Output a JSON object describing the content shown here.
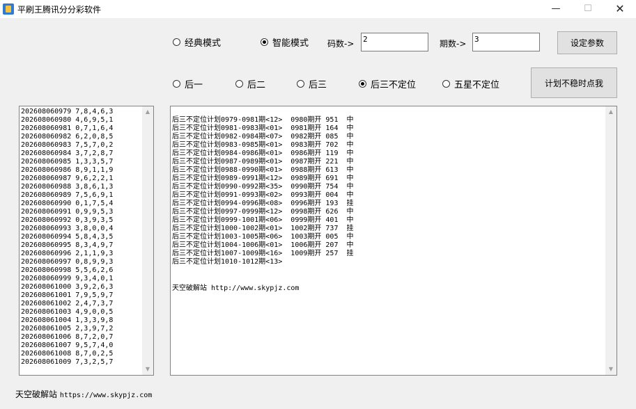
{
  "window": {
    "title": "平刷王腾讯分分彩软件",
    "min": "—",
    "max": "☐",
    "close": "✕"
  },
  "modes": [
    {
      "label": "经典模式",
      "checked": false
    },
    {
      "label": "智能模式",
      "checked": true
    }
  ],
  "params": {
    "code_label": "码数->",
    "code_value": "2",
    "period_label": "期数->",
    "period_value": "3",
    "set_button": "设定参数",
    "plan_button": "计划不稳时点我"
  },
  "positions": [
    {
      "label": "后一",
      "checked": false
    },
    {
      "label": "后二",
      "checked": false
    },
    {
      "label": "后三",
      "checked": false
    },
    {
      "label": "后三不定位",
      "checked": true
    },
    {
      "label": "五星不定位",
      "checked": false
    }
  ],
  "history": [
    "202608060979 7,8,4,6,3",
    "202608060980 4,6,9,5,1",
    "202608060981 0,7,1,6,4",
    "202608060982 6,2,0,8,5",
    "202608060983 7,5,7,0,2",
    "202608060984 3,7,2,8,7",
    "202608060985 1,3,3,5,7",
    "202608060986 8,9,1,1,9",
    "202608060987 9,6,2,2,1",
    "202608060988 3,8,6,1,3",
    "202608060989 7,5,6,9,1",
    "202608060990 0,1,7,5,4",
    "202608060991 0,9,9,5,3",
    "202608060992 0,3,9,3,5",
    "202608060993 3,8,0,0,4",
    "202608060994 5,8,4,3,5",
    "202608060995 8,3,4,9,7",
    "202608060996 2,1,1,9,3",
    "202608060997 0,8,9,9,3",
    "202608060998 5,5,6,2,6",
    "202608060999 9,3,4,0,1",
    "202608061000 3,9,2,6,3",
    "202608061001 7,9,5,9,7",
    "202608061002 2,4,7,3,7",
    "202608061003 4,9,0,0,5",
    "202608061004 1,3,3,9,8",
    "202608061005 2,3,9,7,2",
    "202608061006 8,7,2,0,7",
    "202608061007 9,5,7,4,0",
    "202608061008 8,7,0,2,5",
    "202608061009 7,3,2,5,7"
  ],
  "plan_lines": [
    "后三不定位计划0979-0981期<12>  0980期开 951  中",
    "后三不定位计划0981-0983期<01>  0981期开 164  中",
    "后三不定位计划0982-0984期<07>  0982期开 085  中",
    "后三不定位计划0983-0985期<01>  0983期开 702  中",
    "后三不定位计划0984-0986期<01>  0986期开 119  中",
    "后三不定位计划0987-0989期<01>  0987期开 221  中",
    "后三不定位计划0988-0990期<01>  0988期开 613  中",
    "后三不定位计划0989-0991期<12>  0989期开 691  中",
    "后三不定位计划0990-0992期<35>  0990期开 754  中",
    "后三不定位计划0991-0993期<02>  0993期开 004  中",
    "后三不定位计划0994-0996期<08>  0996期开 193  挂",
    "后三不定位计划0997-0999期<12>  0998期开 626  中",
    "后三不定位计划0999-1001期<06>  0999期开 401  中",
    "后三不定位计划1000-1002期<01>  1002期开 737  挂",
    "后三不定位计划1003-1005期<06>  1003期开 005  中",
    "后三不定位计划1004-1006期<01>  1006期开 207  中",
    "后三不定位计划1007-1009期<16>  1009期开 257  挂",
    "后三不定位计划1010-1012期<13>"
  ],
  "plan_footer": "天空破解站 http://www.skypjz.com",
  "bottom": {
    "text": "天空破解站 ",
    "url": "https://www.skypjz.com"
  },
  "scroll": {
    "up": "▲",
    "down": "▼"
  }
}
